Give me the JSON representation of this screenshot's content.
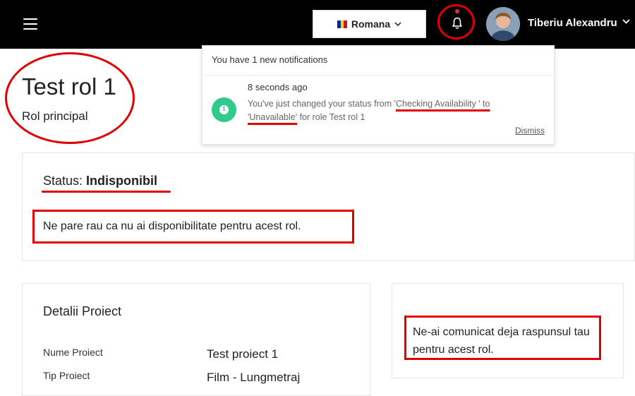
{
  "header": {
    "language": "Romana",
    "language_flag_colors": [
      "#002b7f",
      "#fcd116",
      "#ce1126"
    ],
    "user_name": "Tiberiu Alexandru",
    "notification_dot_color": "#e3342f"
  },
  "page": {
    "title": "Test rol 1",
    "subtitle": "Rol principal"
  },
  "status": {
    "label": "Status:",
    "value": "Indisponibil",
    "message": "Ne pare rau ca nu ai disponibilitate pentru acest rol."
  },
  "details": {
    "title": "Detalii Proiect",
    "rows": [
      {
        "label": "Nume Proiect",
        "value": "Test proiect 1"
      },
      {
        "label": "Tip Proiect",
        "value": "Film - Lungmetraj"
      }
    ]
  },
  "reply": {
    "message": "Ne-ai comunicat deja raspunsul tau pentru acest rol."
  },
  "notifications": {
    "header": "You have 1 new notifications",
    "items": [
      {
        "time": "8 seconds ago",
        "message_part1": "You've just changed your status from '",
        "old_status": "Checking Availability ' to",
        "message_part2": " ",
        "new_status": "'Unavailable'",
        "message_part3": " for role Test rol 1",
        "icon": "info-icon"
      }
    ],
    "dismiss_label": "Dismiss"
  },
  "colors": {
    "accent_annotation": "#e10000",
    "notification_icon_bg": "#2ecb8c"
  }
}
